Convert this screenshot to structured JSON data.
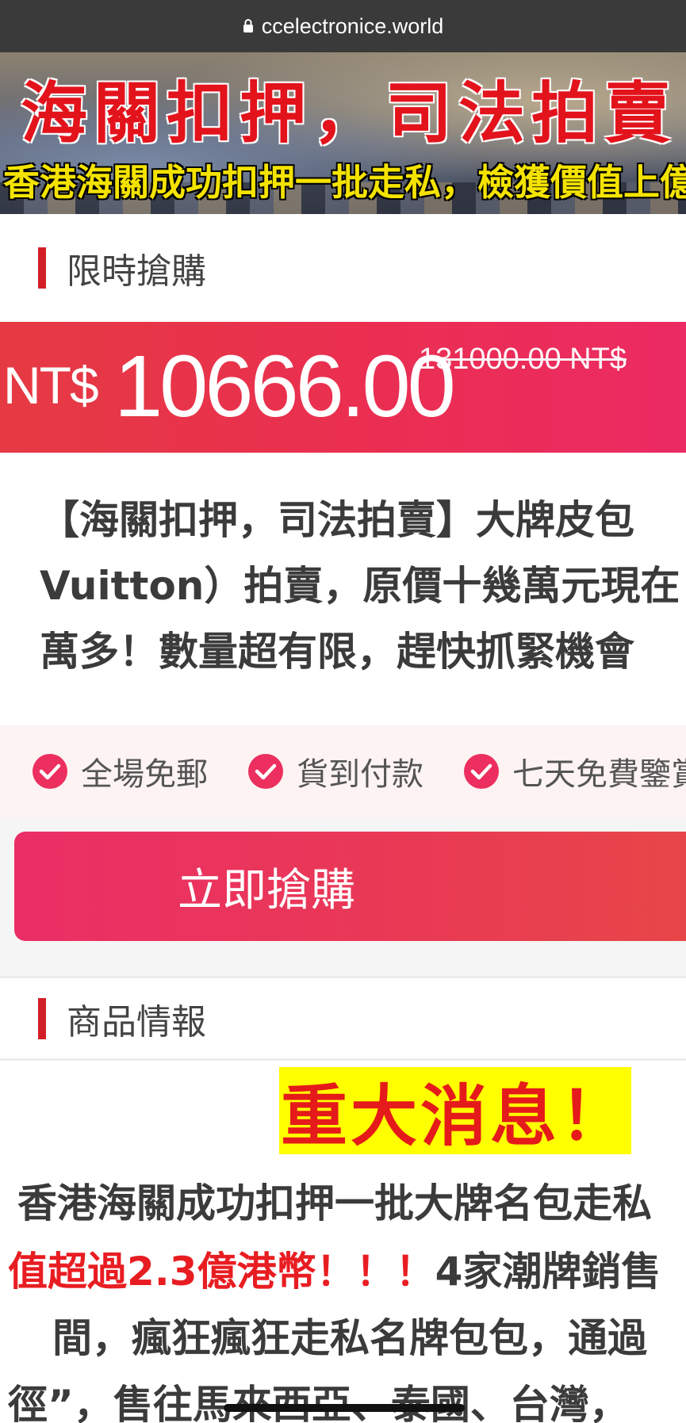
{
  "browser": {
    "url": "ccelectronice.world",
    "lock_icon": "lock-icon"
  },
  "banner": {
    "title": "海關扣押，司法拍賣",
    "subtitle": "香港海關成功扣押一批走私，檢獲價值上億"
  },
  "flash_sale": {
    "section_title": "限時搶購",
    "currency": "NT$",
    "price": "10666.00",
    "original_price": "131000.00 NT$",
    "description_lines": [
      "【海關扣押，司法拍賣】大牌皮包",
      "Vuitton）拍賣，原價十幾萬元現在",
      "萬多！數量超有限，趕快抓緊機會"
    ]
  },
  "features": [
    {
      "icon": "check-circle-icon",
      "label": "全場免郵"
    },
    {
      "icon": "check-circle-icon",
      "label": "貨到付款"
    },
    {
      "icon": "check-circle-icon",
      "label": "七天免費鑒賞"
    }
  ],
  "buy_button": {
    "label": "立即搶購"
  },
  "product_info": {
    "section_title": "商品情報",
    "headline": "重大消息！",
    "line1": "香港海關成功扣押一批大牌名包走私",
    "line2_red": "值超過2.3億港幣！！！",
    "line2_rest": "4家潮牌銷售",
    "line3": "間，瘋狂瘋狂走私名牌包包，通過",
    "line4": "徑”，售往馬來西亞、泰國、台灣，"
  },
  "colors": {
    "accent_red": "#e53a43",
    "accent_pink": "#ec2a63",
    "headline_bg": "#ffff00",
    "headline_text": "#e51a1a",
    "section_bar": "#d21f26"
  }
}
